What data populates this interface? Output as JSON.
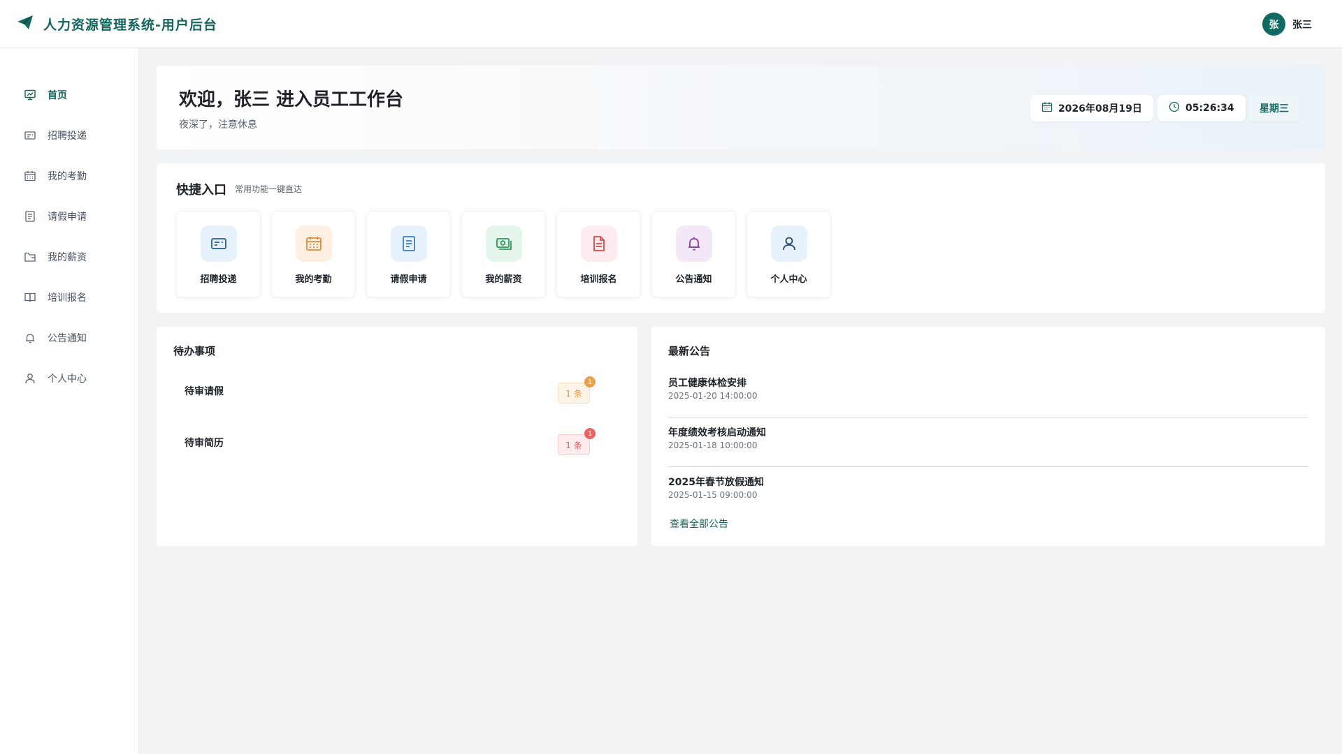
{
  "app": {
    "title": "人力资源管理系统-用户后台",
    "brand_icon": "paper-plane-icon",
    "accent": "#16665e"
  },
  "user": {
    "avatar_char": "张",
    "name": "张三"
  },
  "sidebar": {
    "items": [
      {
        "label": "首页",
        "icon": "presentation-chart-icon",
        "active": true
      },
      {
        "label": "招聘投递",
        "icon": "id-card-icon",
        "active": false
      },
      {
        "label": "我的考勤",
        "icon": "calendar-icon",
        "active": false
      },
      {
        "label": "请假申请",
        "icon": "document-icon",
        "active": false
      },
      {
        "label": "我的薪资",
        "icon": "wallet-icon",
        "active": false
      },
      {
        "label": "培训报名",
        "icon": "book-icon",
        "active": false
      },
      {
        "label": "公告通知",
        "icon": "bell-icon",
        "active": false
      },
      {
        "label": "个人中心",
        "icon": "user-icon",
        "active": false
      }
    ]
  },
  "welcome": {
    "title": "欢迎，张三 进入员工工作台",
    "subtitle": "夜深了，注意休息",
    "date": "2026年08月19日",
    "time": "05:26:34",
    "weekday": "星期三"
  },
  "quick": {
    "title": "快捷入口",
    "subtitle": "常用功能一键直达",
    "items": [
      {
        "label": "招聘投递",
        "icon": "id-card-icon",
        "bg": "#e6f1fb",
        "color": "#2a5d8a"
      },
      {
        "label": "我的考勤",
        "icon": "calendar-icon",
        "bg": "#fdf0e2",
        "color": "#e0893a"
      },
      {
        "label": "请假申请",
        "icon": "document-icon",
        "bg": "#e6f1fb",
        "color": "#3d7fb8"
      },
      {
        "label": "我的薪资",
        "icon": "money-icon",
        "bg": "#e4f5ec",
        "color": "#2f9a5a"
      },
      {
        "label": "培训报名",
        "icon": "file-icon",
        "bg": "#fdebef",
        "color": "#d24a4a"
      },
      {
        "label": "公告通知",
        "icon": "bell-icon",
        "bg": "#f3e8f7",
        "color": "#8e3fa8"
      },
      {
        "label": "个人中心",
        "icon": "user-icon",
        "bg": "#e6f1fb",
        "color": "#2c4a66"
      }
    ]
  },
  "todo": {
    "title": "待办事项",
    "items": [
      {
        "label": "待审请假",
        "tag": "1 条",
        "badge": "1",
        "tag_bg": "#fdf3e6",
        "tag_color": "#e89a3a",
        "badge_color": "#e8a04a"
      },
      {
        "label": "待审简历",
        "tag": "1 条",
        "badge": "1",
        "tag_bg": "#fdeceb",
        "tag_color": "#e06060",
        "badge_color": "#ea6262"
      }
    ]
  },
  "notice": {
    "title": "最新公告",
    "items": [
      {
        "title": "员工健康体检安排",
        "time": "2025-01-20 14:00:00"
      },
      {
        "title": "年度绩效考核启动通知",
        "time": "2025-01-18 10:00:00"
      },
      {
        "title": "2025年春节放假通知",
        "time": "2025-01-15 09:00:00"
      }
    ],
    "more": "查看全部公告"
  }
}
